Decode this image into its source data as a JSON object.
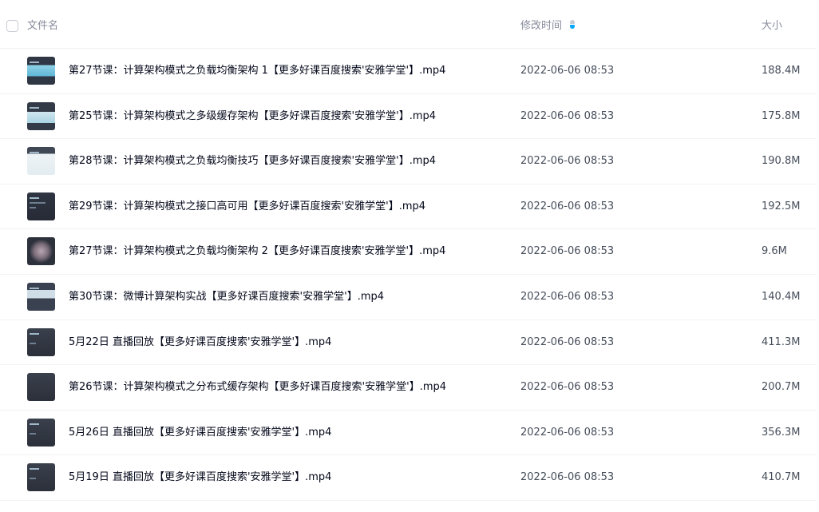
{
  "header": {
    "name_label": "文件名",
    "time_label": "修改时间",
    "size_label": "大小",
    "sort_icon": "sort-descending-icon",
    "accent_color": "#06a7ff"
  },
  "files": [
    {
      "name": "第27节课：计算架构模式之负载均衡架构 1【更多好课百度搜索'安雅学堂'】.mp4",
      "time": "2022-06-06 08:53",
      "size": "188.4M",
      "thumb": "video-thumbnail"
    },
    {
      "name": "第25节课：计算架构模式之多级缓存架构【更多好课百度搜索'安雅学堂'】.mp4",
      "time": "2022-06-06 08:53",
      "size": "175.8M",
      "thumb": "video-thumbnail"
    },
    {
      "name": "第28节课：计算架构模式之负载均衡技巧【更多好课百度搜索'安雅学堂'】.mp4",
      "time": "2022-06-06 08:53",
      "size": "190.8M",
      "thumb": "video-thumbnail"
    },
    {
      "name": "第29节课：计算架构模式之接口高可用【更多好课百度搜索'安雅学堂'】.mp4",
      "time": "2022-06-06 08:53",
      "size": "192.5M",
      "thumb": "video-thumbnail"
    },
    {
      "name": "第27节课：计算架构模式之负载均衡架构 2【更多好课百度搜索'安雅学堂'】.mp4",
      "time": "2022-06-06 08:53",
      "size": "9.6M",
      "thumb": "video-thumbnail"
    },
    {
      "name": "第30节课：微博计算架构实战【更多好课百度搜索'安雅学堂'】.mp4",
      "time": "2022-06-06 08:53",
      "size": "140.4M",
      "thumb": "video-thumbnail"
    },
    {
      "name": "5月22日 直播回放【更多好课百度搜索'安雅学堂'】.mp4",
      "time": "2022-06-06 08:53",
      "size": "411.3M",
      "thumb": "video-thumbnail"
    },
    {
      "name": "第26节课：计算架构模式之分布式缓存架构【更多好课百度搜索'安雅学堂'】.mp4",
      "time": "2022-06-06 08:53",
      "size": "200.7M",
      "thumb": "video-thumbnail"
    },
    {
      "name": "5月26日 直播回放【更多好课百度搜索'安雅学堂'】.mp4",
      "time": "2022-06-06 08:53",
      "size": "356.3M",
      "thumb": "video-thumbnail"
    },
    {
      "name": "5月19日 直播回放【更多好课百度搜索'安雅学堂'】.mp4",
      "time": "2022-06-06 08:53",
      "size": "410.7M",
      "thumb": "video-thumbnail"
    }
  ]
}
